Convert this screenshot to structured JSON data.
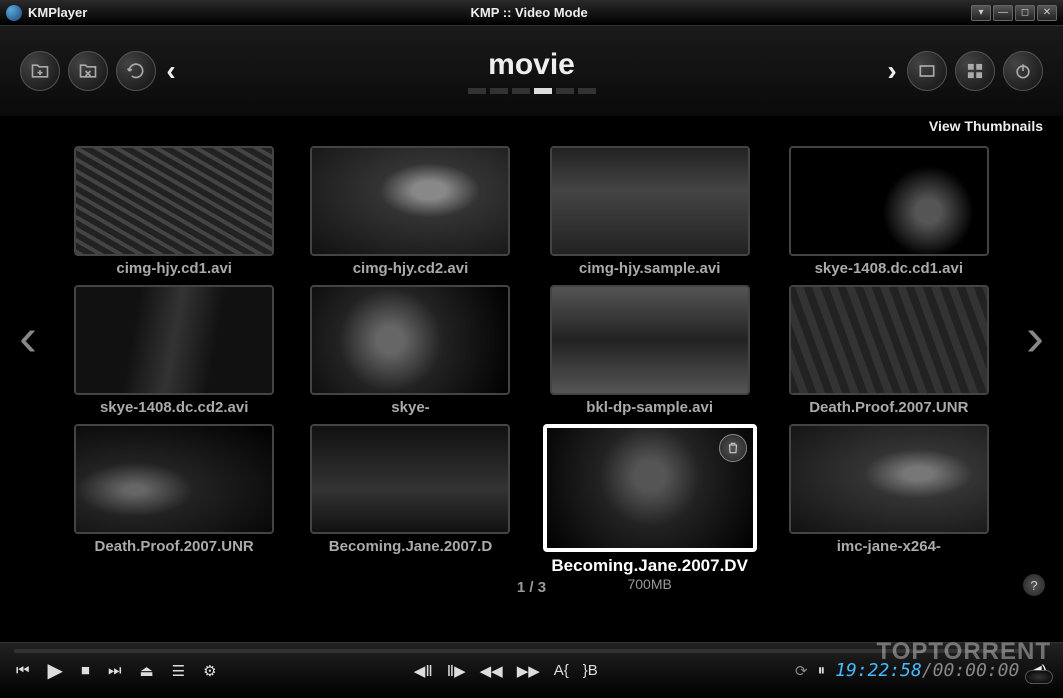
{
  "titlebar": {
    "app_name": "KMPlayer",
    "window_title": "KMP :: Video Mode"
  },
  "toolbar": {
    "category": "movie",
    "view_mode": "View Thumbnails"
  },
  "thumbnails": [
    {
      "name": "cimg-hjy.cd1.avi"
    },
    {
      "name": "cimg-hjy.cd2.avi"
    },
    {
      "name": "cimg-hjy.sample.avi"
    },
    {
      "name": "skye-1408.dc.cd1.avi"
    },
    {
      "name": "skye-1408.dc.cd2.avi"
    },
    {
      "name": "skye-"
    },
    {
      "name": "bkl-dp-sample.avi"
    },
    {
      "name": "Death.Proof.2007.UNR"
    },
    {
      "name": "Death.Proof.2007.UNR"
    },
    {
      "name": "Becoming.Jane.2007.D"
    },
    {
      "name": "Becoming.Jane.2007.DV",
      "size": "700MB",
      "selected": true
    },
    {
      "name": "imc-jane-x264-"
    }
  ],
  "pager": "1 / 3",
  "playback": {
    "current_time": "19:22:58",
    "total_time": "00:00:00"
  },
  "watermark": "TOPTORRENT"
}
